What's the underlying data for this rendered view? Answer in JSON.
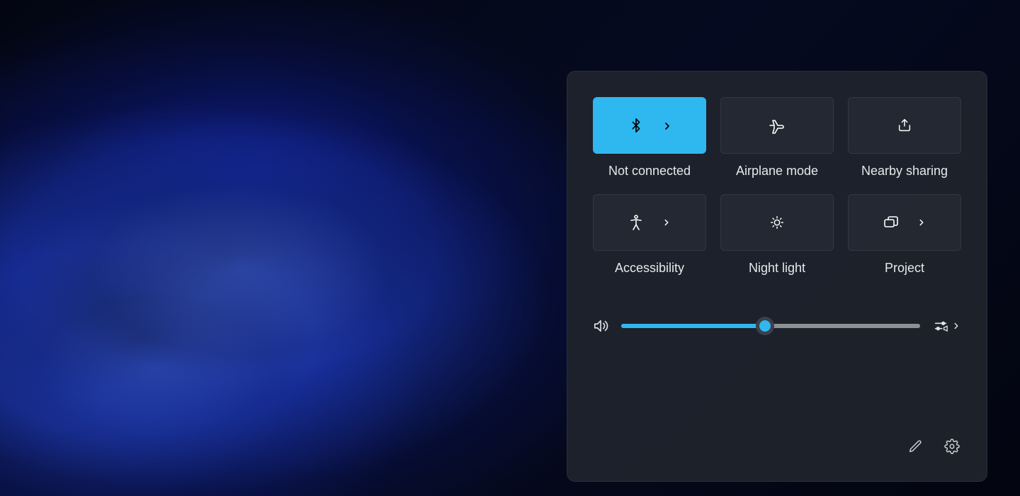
{
  "panel": {
    "tiles": [
      {
        "id": "bluetooth",
        "label": "Not connected",
        "icon": "bluetooth",
        "active": true,
        "has_chevron": true
      },
      {
        "id": "airplane",
        "label": "Airplane mode",
        "icon": "airplane",
        "active": false,
        "has_chevron": false
      },
      {
        "id": "nearby",
        "label": "Nearby sharing",
        "icon": "share",
        "active": false,
        "has_chevron": false
      },
      {
        "id": "accessibility",
        "label": "Accessibility",
        "icon": "accessibility",
        "active": false,
        "has_chevron": true
      },
      {
        "id": "nightlight",
        "label": "Night light",
        "icon": "nightlight",
        "active": false,
        "has_chevron": false
      },
      {
        "id": "project",
        "label": "Project",
        "icon": "project",
        "active": false,
        "has_chevron": true
      }
    ],
    "volume": {
      "percent": 48
    },
    "colors": {
      "accent": "#2fb7f0",
      "panel_bg": "rgba(32,36,45,0.92)"
    }
  }
}
